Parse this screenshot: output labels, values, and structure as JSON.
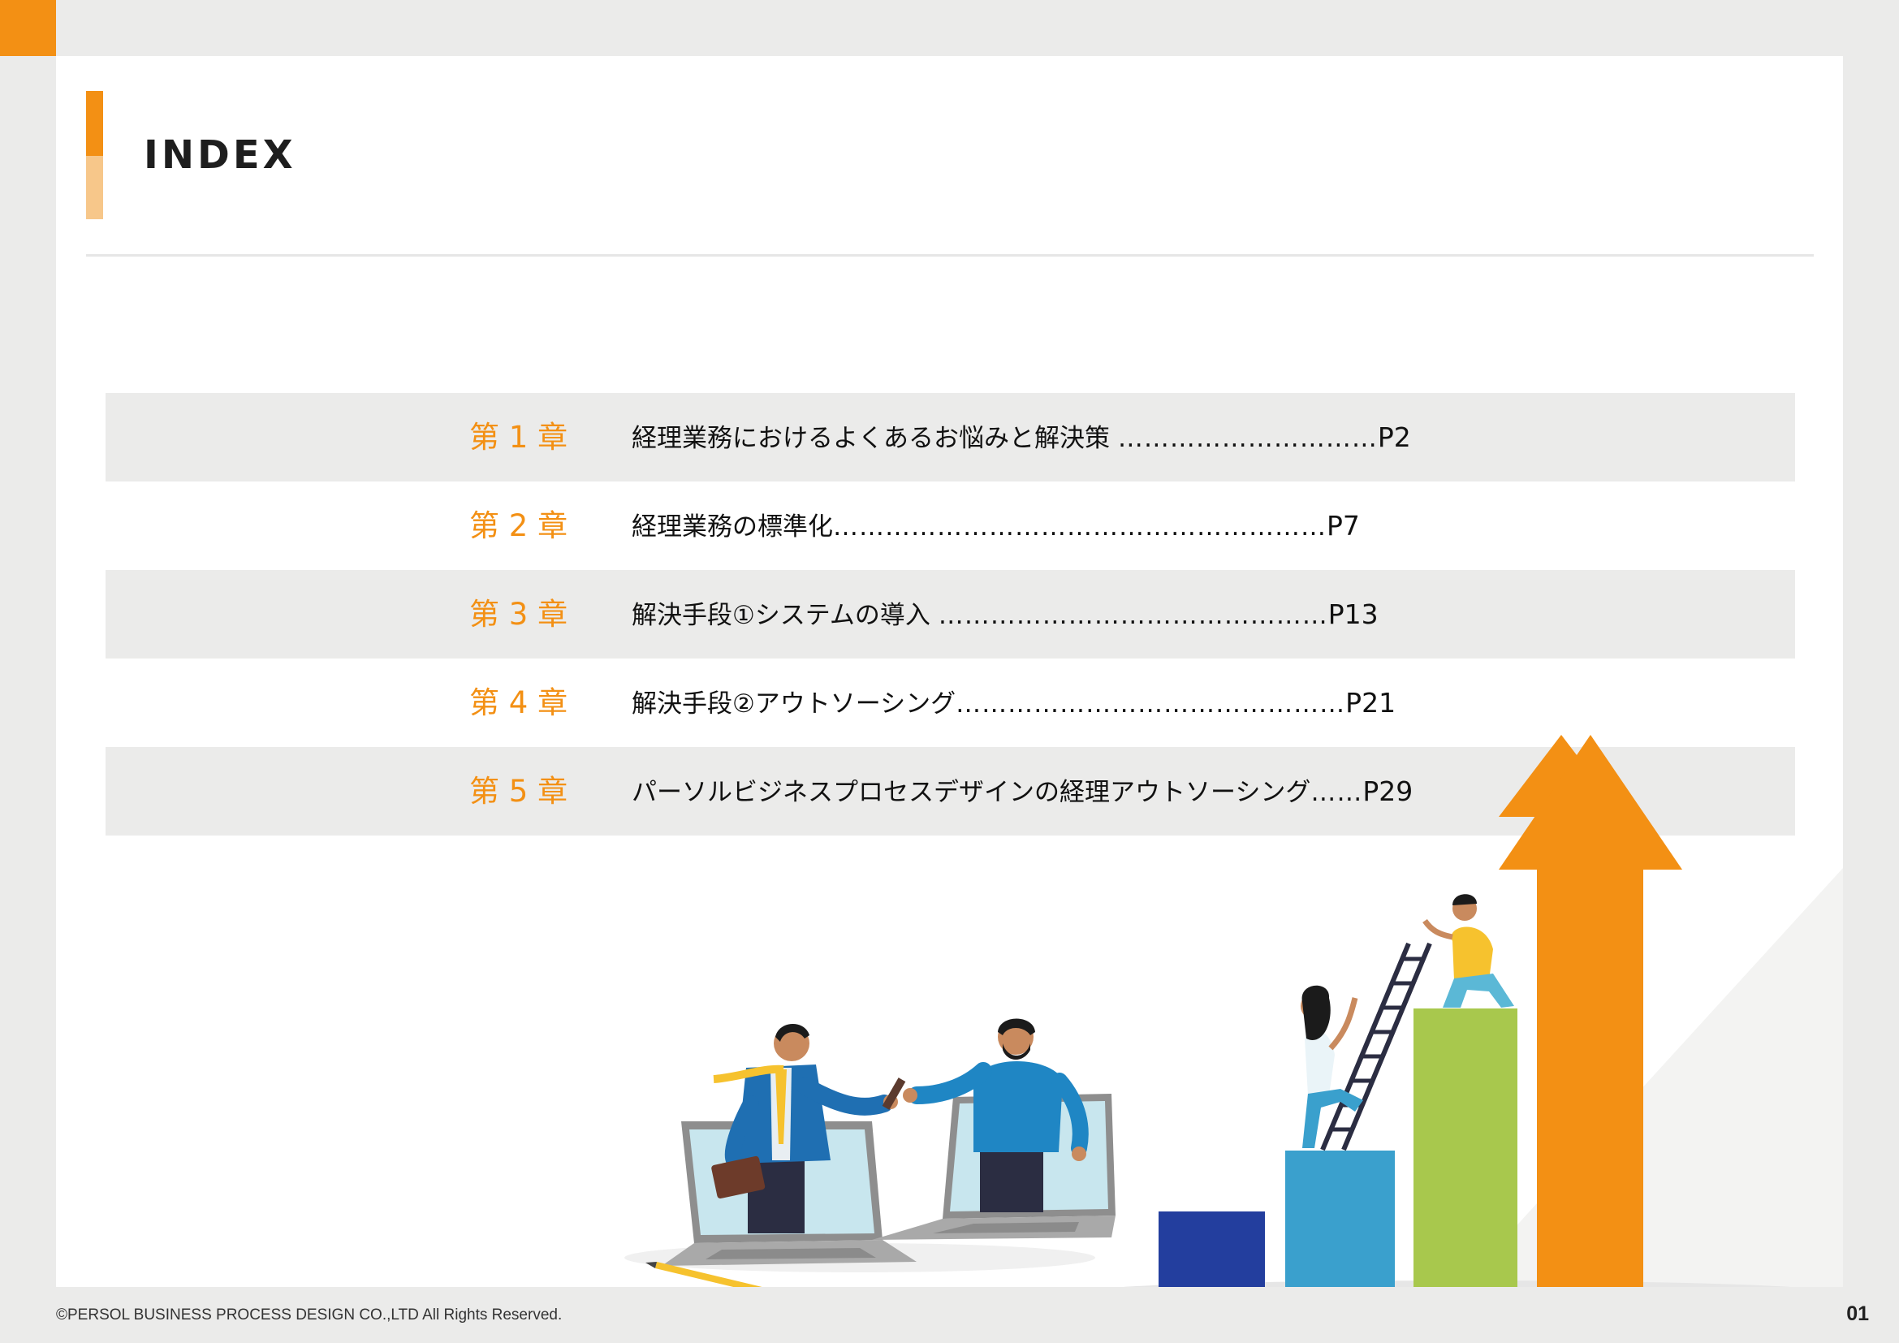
{
  "header": {
    "title": "INDEX"
  },
  "toc": [
    {
      "chapter": "第 1 章",
      "title": "経理業務におけるよくあるお悩みと解決策 ",
      "dots": "…………………………",
      "page": "P2"
    },
    {
      "chapter": "第 2 章",
      "title": "経理業務の標準化",
      "dots": "…………………………………………………",
      "page": "P7"
    },
    {
      "chapter": "第 3 章",
      "title": "解決手段①システムの導入 ",
      "dots": "………………………………………",
      "page": "P13"
    },
    {
      "chapter": "第 4 章",
      "title": "解決手段②アウトソーシング",
      "dots": "………………………………………",
      "page": "P21"
    },
    {
      "chapter": "第 5 章",
      "title": "パーソルビジネスプロセスデザインの経理アウトソーシング",
      "dots": "……",
      "page": "P29"
    }
  ],
  "footer": {
    "copyright": "©PERSOL BUSINESS PROCESS DESIGN CO.,LTD All Rights Reserved.",
    "page_number": "01"
  },
  "colors": {
    "accent": "#f39014",
    "accent_light": "#f7c78a",
    "row_shade": "#ebebea",
    "bar_navy": "#233e9e",
    "bar_blue": "#3aa0cd",
    "bar_green": "#a8c84d"
  }
}
